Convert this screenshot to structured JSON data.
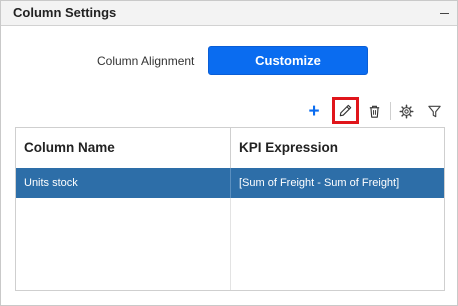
{
  "panel": {
    "title": "Column Settings"
  },
  "alignment": {
    "label": "Column Alignment",
    "button_label": "Customize"
  },
  "toolbar": {
    "add": "+",
    "icons": [
      "plus-icon",
      "pencil-icon",
      "trash-icon",
      "gear-icon",
      "filter-icon"
    ],
    "accent_color": "#0a6cf0",
    "highlight_color": "#e0151b"
  },
  "grid": {
    "columns": [
      "Column Name",
      "KPI Expression"
    ],
    "rows": [
      {
        "column_name": "Units stock",
        "kpi_expression": "[Sum of Freight - Sum of Freight]"
      }
    ],
    "selected_row_color": "#2d6ea8"
  }
}
